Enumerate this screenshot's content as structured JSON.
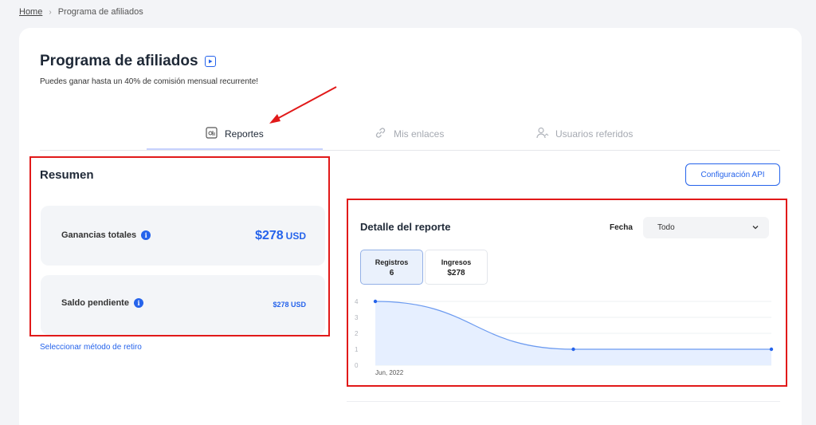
{
  "breadcrumb": {
    "home": "Home",
    "current": "Programa de afiliados"
  },
  "page": {
    "title": "Programa de afiliados",
    "subtitle": "Puedes ganar hasta un 40% de comisión mensual recurrente!"
  },
  "tabs": [
    {
      "label": "Reportes",
      "icon": "report-icon",
      "active": true
    },
    {
      "label": "Mis enlaces",
      "icon": "link-icon",
      "active": false
    },
    {
      "label": "Usuarios referidos",
      "icon": "users-icon",
      "active": false
    }
  ],
  "resumen": {
    "title": "Resumen",
    "ganancias_label": "Ganancias totales",
    "ganancias_amount": "$278",
    "ganancias_unit": "USD",
    "saldo_label": "Saldo pendiente",
    "saldo_value": "$278 USD",
    "link_retiro": "Seleccionar método de retiro"
  },
  "config_button": "Configuración API",
  "report": {
    "title": "Detalle del reporte",
    "fecha_label": "Fecha",
    "fecha_value": "Todo",
    "metrics": [
      {
        "label": "Registros",
        "value": "6"
      },
      {
        "label": "Ingresos",
        "value": "$278"
      }
    ]
  },
  "colors": {
    "accent": "#2563eb",
    "highlight": "#e11919",
    "area": "#e6efff"
  },
  "chart_data": {
    "type": "area",
    "x": [
      "Jun, 2022",
      "",
      ""
    ],
    "values": [
      4,
      1,
      1
    ],
    "y_ticks": [
      4,
      3,
      2,
      1,
      0
    ],
    "ylim": [
      0,
      4
    ],
    "x_tick_labels": [
      "Jun, 2022"
    ],
    "grid": true
  }
}
